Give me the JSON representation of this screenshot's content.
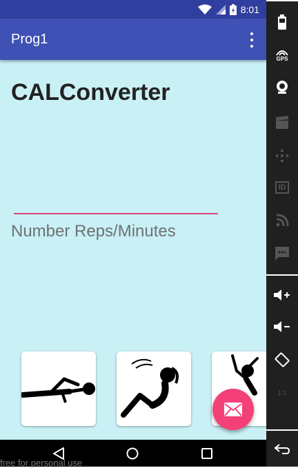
{
  "status_bar": {
    "time": "8:01"
  },
  "app_bar": {
    "title": "Prog1"
  },
  "main": {
    "heading": "CALConverter",
    "input": {
      "value": "",
      "placeholder": "Number Reps/Minutes"
    }
  },
  "exercises": [
    {
      "name": "pushups"
    },
    {
      "name": "situps"
    },
    {
      "name": "jumping"
    }
  ],
  "fab": {
    "icon": "email-icon"
  },
  "nav": {
    "back": "back-icon",
    "home": "home-icon",
    "recents": "recents-icon"
  },
  "side_panel": {
    "gps_label": "GPS",
    "id_label": "ID",
    "scale_label": "1:1"
  },
  "footer": {
    "watermark": "free for personal use"
  },
  "colors": {
    "status_bar": "#303f9f",
    "app_bar": "#3f51b5",
    "background": "#c8f0f5",
    "accent": "#f44079",
    "underline": "#e0457a"
  }
}
